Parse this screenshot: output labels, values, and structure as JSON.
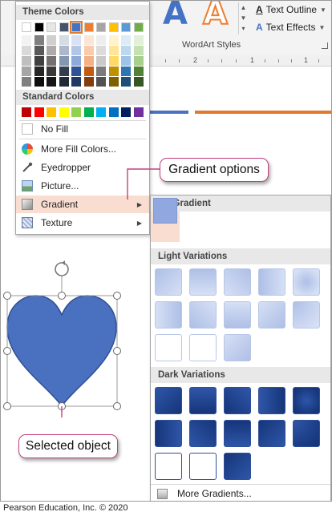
{
  "ribbon": {
    "text_outline_label": "Text Outline",
    "text_effects_label": "Text Effects",
    "wordart_styles_label": "WordArt Styles",
    "wordart_letter": "A",
    "ruler_numbers": [
      "2",
      "1",
      "1"
    ]
  },
  "color_menu": {
    "theme_colors_header": "Theme Colors",
    "theme_columns": [
      [
        "#ffffff",
        "#f2f2f2",
        "#d9d9d9",
        "#bfbfbf",
        "#a6a6a6",
        "#808080"
      ],
      [
        "#000000",
        "#7f7f7f",
        "#595959",
        "#404040",
        "#262626",
        "#0d0d0d"
      ],
      [
        "#e7e6e6",
        "#d0cece",
        "#aeaaaa",
        "#757070",
        "#3a3838",
        "#171616"
      ],
      [
        "#44546a",
        "#d6dce4",
        "#adb9ca",
        "#8496b0",
        "#333f4f",
        "#222a35"
      ],
      [
        "#4472c4",
        "#d9e2f3",
        "#b4c6e7",
        "#8eaadb",
        "#2f5496",
        "#1f3864"
      ],
      [
        "#ed7d31",
        "#fbe5d5",
        "#f7cbac",
        "#f4b183",
        "#c55a11",
        "#833c0b"
      ],
      [
        "#a5a5a5",
        "#ededed",
        "#dbdbdb",
        "#c9c9c9",
        "#7b7b7b",
        "#525252"
      ],
      [
        "#ffc000",
        "#fff2cc",
        "#ffe599",
        "#ffd966",
        "#bf9000",
        "#7f6000"
      ],
      [
        "#5b9bd5",
        "#deebf6",
        "#bdd7ee",
        "#9dc3e6",
        "#2e75b5",
        "#1f4e79"
      ],
      [
        "#70ad47",
        "#e2efd9",
        "#c5e0b3",
        "#a8d08d",
        "#538135",
        "#375623"
      ]
    ],
    "standard_colors_header": "Standard Colors",
    "standard_colors": [
      "#c00000",
      "#ff0000",
      "#ffc000",
      "#ffff00",
      "#92d050",
      "#00b050",
      "#00b0f0",
      "#0070c0",
      "#002060",
      "#7030a0"
    ],
    "items": {
      "no_fill": "No Fill",
      "more_fill_colors": "More Fill Colors...",
      "eyedropper": "Eyedropper",
      "picture": "Picture...",
      "gradient": "Gradient",
      "texture": "Texture"
    }
  },
  "gallery": {
    "no_gradient_header": "No Gradient",
    "light_variations_header": "Light Variations",
    "dark_variations_header": "Dark Variations",
    "more_gradients": "More Gradients...",
    "light_color": "#d6e0f5",
    "dark_color": "#2e56a8"
  },
  "callouts": {
    "gradient_options": "Gradient options",
    "selected_object": "Selected object"
  },
  "shape": {
    "fill": "#4a70c0",
    "outline": "#2f4f96"
  },
  "copyright": "Pearson Education, Inc. © 2020"
}
